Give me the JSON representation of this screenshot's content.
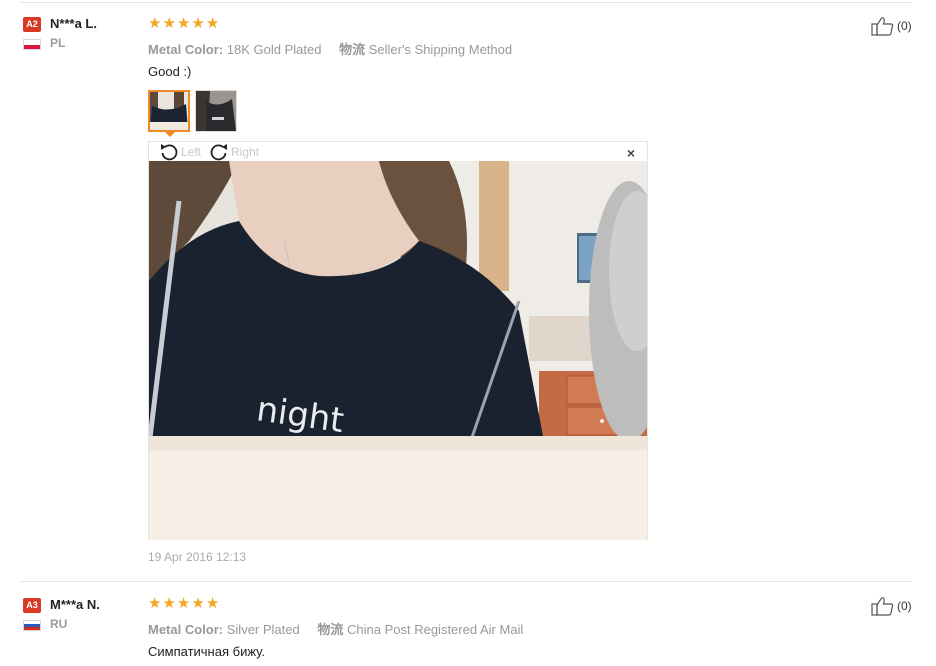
{
  "colors": {
    "accent_orange": "#f08a24",
    "star": "#f5a623",
    "badge_red": "#d93a26"
  },
  "reviews": [
    {
      "badge": "A2",
      "user": "N***a L.",
      "country": "PL",
      "flag_icon": "poland-flag-icon",
      "rating": 5,
      "attr_key": "Metal Color:",
      "attr_value": "18K Gold Plated",
      "ship_label": "物流",
      "ship_value": "Seller's Shipping Method",
      "text": "Good :)",
      "likes": "(0)",
      "date": "19 Apr 2016 12:13",
      "viewer": {
        "rotate_left": "Left",
        "rotate_right": "Right",
        "close": "×",
        "shirt_text": "night"
      }
    },
    {
      "badge": "A3",
      "user": "M***a N.",
      "country": "RU",
      "flag_icon": "russia-flag-icon",
      "rating": 5,
      "attr_key": "Metal Color:",
      "attr_value": "Silver Plated",
      "ship_label": "物流",
      "ship_value": "China Post Registered Air Mail",
      "text": "Симпатичная бижу.",
      "likes": "(0)"
    }
  ]
}
